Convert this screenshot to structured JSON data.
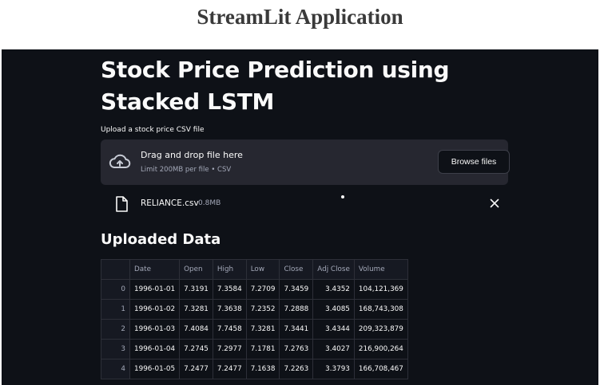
{
  "caption": "StreamLit Application",
  "app": {
    "title": "Stock Price Prediction using Stacked LSTM",
    "uploader": {
      "label": "Upload a stock price CSV file",
      "drop_text": "Drag and drop file here",
      "limit_text": "Limit 200MB per file • CSV",
      "browse_label": "Browse files"
    },
    "uploaded_file": {
      "name": "RELIANCE.csv",
      "size": "0.8MB"
    },
    "section_heading": "Uploaded Data",
    "table": {
      "columns": [
        "Date",
        "Open",
        "High",
        "Low",
        "Close",
        "Adj Close",
        "Volume"
      ],
      "rows": [
        {
          "index": "0",
          "cells": [
            "1996-01-01",
            "7.3191",
            "7.3584",
            "7.2709",
            "7.3459",
            "3.4352",
            "104,121,369"
          ]
        },
        {
          "index": "1",
          "cells": [
            "1996-01-02",
            "7.3281",
            "7.3638",
            "7.2352",
            "7.2888",
            "3.4085",
            "168,743,308"
          ]
        },
        {
          "index": "2",
          "cells": [
            "1996-01-03",
            "7.4084",
            "7.7458",
            "7.3281",
            "7.3441",
            "3.4344",
            "209,323,879"
          ]
        },
        {
          "index": "3",
          "cells": [
            "1996-01-04",
            "7.2745",
            "7.2977",
            "7.1781",
            "7.2763",
            "3.4027",
            "216,900,264"
          ]
        },
        {
          "index": "4",
          "cells": [
            "1996-01-05",
            "7.2477",
            "7.2477",
            "7.1638",
            "7.2263",
            "3.3793",
            "166,708,467"
          ]
        }
      ]
    },
    "colors": {
      "background": "#0e1117",
      "surface": "#262730",
      "text": "#fafafa",
      "muted": "#a3a8b8"
    },
    "icons": {
      "upload": "cloud-upload-icon",
      "file": "file-icon",
      "remove": "close-icon"
    }
  }
}
